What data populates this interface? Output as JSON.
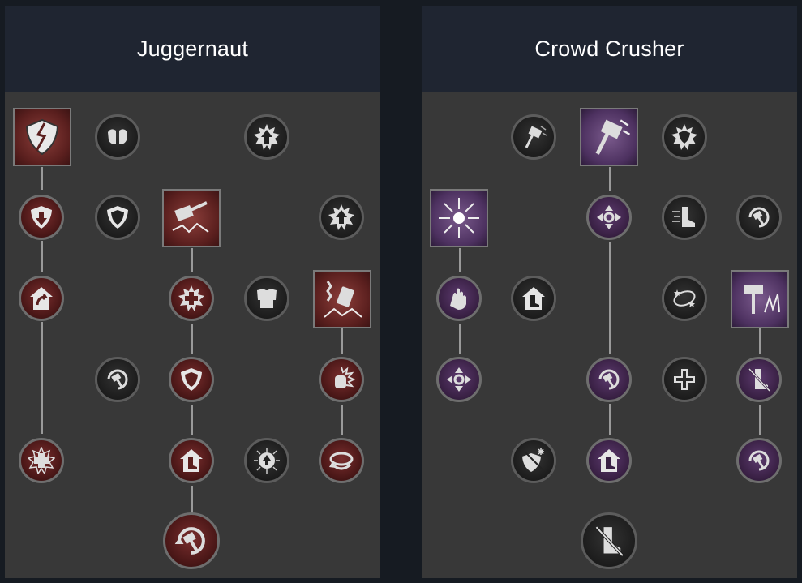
{
  "trees": [
    {
      "title": "Juggernaut",
      "theme": "red",
      "accent": "#5a1f1e",
      "nodes": [
        {
          "id": "j1",
          "type": "square",
          "icon": "broken-shield-icon",
          "active": true
        },
        {
          "id": "j2",
          "type": "circle",
          "icon": "shoulder-armor-icon",
          "active": false
        },
        {
          "id": "j3",
          "type": "circle",
          "icon": "spiked-arrow-up-icon",
          "active": false
        },
        {
          "id": "j4",
          "type": "circle",
          "icon": "shield-down-arrow-icon",
          "active": true
        },
        {
          "id": "j5",
          "type": "circle",
          "icon": "shield-icon",
          "active": false
        },
        {
          "id": "j6",
          "type": "square",
          "icon": "hammer-slam-icon",
          "active": true
        },
        {
          "id": "j7",
          "type": "circle",
          "icon": "spiked-arrow-up-icon",
          "active": false
        },
        {
          "id": "j8",
          "type": "circle",
          "icon": "shield-recover-icon",
          "active": true
        },
        {
          "id": "j9",
          "type": "circle",
          "icon": "spiked-cross-icon",
          "active": true
        },
        {
          "id": "j10",
          "type": "circle",
          "icon": "chest-armor-icon",
          "active": false
        },
        {
          "id": "j11",
          "type": "square",
          "icon": "chained-hammer-icon",
          "active": true
        },
        {
          "id": "j12",
          "type": "circle",
          "icon": "hammer-cooldown-icon",
          "active": false
        },
        {
          "id": "j13",
          "type": "circle",
          "icon": "shield-down-arrow-icon",
          "active": true
        },
        {
          "id": "j14",
          "type": "circle",
          "icon": "flaming-fist-icon",
          "active": true
        },
        {
          "id": "j15",
          "type": "circle",
          "icon": "medical-cross-icon",
          "active": true
        },
        {
          "id": "j16",
          "type": "circle",
          "icon": "boot-arrow-up-icon",
          "active": true
        },
        {
          "id": "j17",
          "type": "circle",
          "icon": "burst-arrow-up-icon",
          "active": false
        },
        {
          "id": "j18",
          "type": "circle",
          "icon": "swirl-icon",
          "active": true
        },
        {
          "id": "j19",
          "type": "circle",
          "icon": "hammer-cooldown-icon",
          "active": true
        }
      ]
    },
    {
      "title": "Crowd Crusher",
      "theme": "purple",
      "accent": "#4d3160",
      "nodes": [
        {
          "id": "c1",
          "type": "circle",
          "icon": "hammer-throw-icon",
          "active": false
        },
        {
          "id": "c2",
          "type": "square",
          "icon": "hammer-throw-icon",
          "active": true
        },
        {
          "id": "c3",
          "type": "circle",
          "icon": "spiked-shield-icon",
          "active": false
        },
        {
          "id": "c4",
          "type": "square",
          "icon": "shatter-burst-icon",
          "active": true
        },
        {
          "id": "c5",
          "type": "circle",
          "icon": "crossed-arrows-icon",
          "active": true
        },
        {
          "id": "c6",
          "type": "circle",
          "icon": "speed-boot-icon",
          "active": false
        },
        {
          "id": "c7",
          "type": "circle",
          "icon": "hammer-cooldown-icon",
          "active": false
        },
        {
          "id": "c8",
          "type": "circle",
          "icon": "hand-push-icon",
          "active": true
        },
        {
          "id": "c9",
          "type": "circle",
          "icon": "boot-arrow-up-icon",
          "active": false
        },
        {
          "id": "c10",
          "type": "circle",
          "icon": "stun-stars-icon",
          "active": false
        },
        {
          "id": "c11",
          "type": "square",
          "icon": "hammer-shockwave-icon",
          "active": true
        },
        {
          "id": "c12",
          "type": "circle",
          "icon": "crossed-arrows-icon",
          "active": true
        },
        {
          "id": "c13",
          "type": "circle",
          "icon": "hammer-cooldown-icon",
          "active": true
        },
        {
          "id": "c14",
          "type": "circle",
          "icon": "medical-cross-icon",
          "active": false
        },
        {
          "id": "c15",
          "type": "circle",
          "icon": "slowed-boot-icon",
          "active": true
        },
        {
          "id": "c16",
          "type": "circle",
          "icon": "frost-shield-icon",
          "active": false
        },
        {
          "id": "c17",
          "type": "circle",
          "icon": "boot-arrow-up-icon",
          "active": true
        },
        {
          "id": "c18",
          "type": "circle",
          "icon": "hammer-cooldown-icon",
          "active": true
        },
        {
          "id": "c19",
          "type": "circle",
          "icon": "slowed-boot-icon",
          "active": false
        }
      ]
    }
  ]
}
